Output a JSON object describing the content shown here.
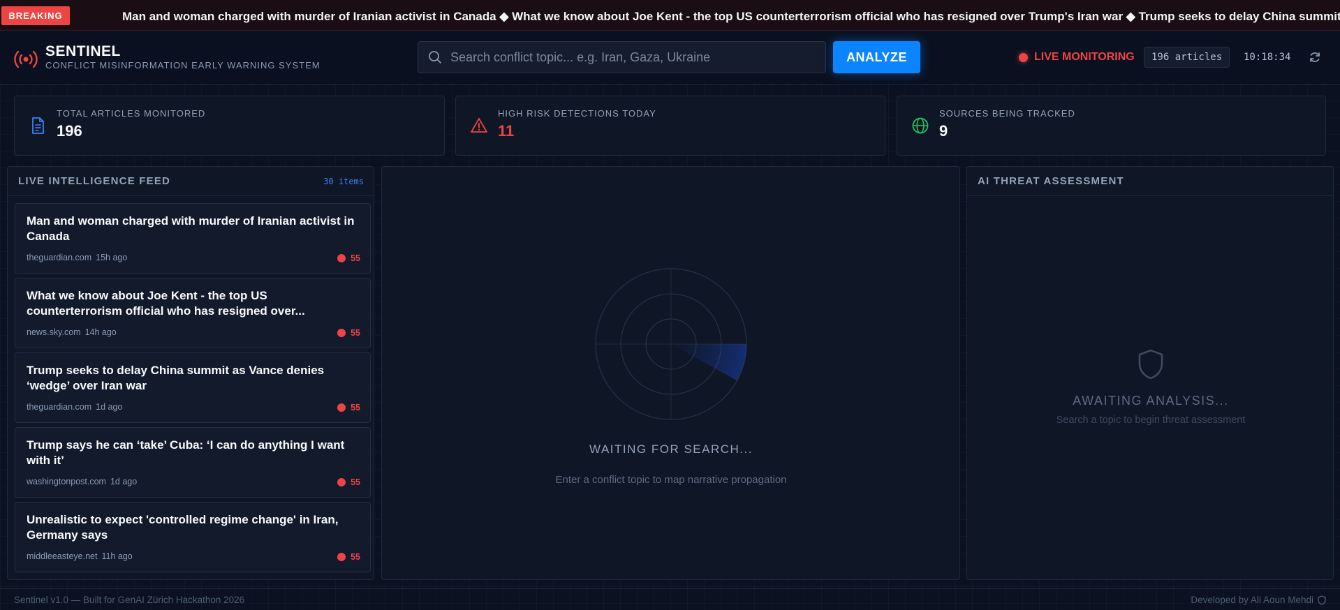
{
  "ticker": {
    "badge": "BREAKING",
    "text": "Man and woman charged with murder of Iranian activist in Canada ◆ What we know about Joe Kent - the top US counterterrorism official who has resigned over Trump's Iran war ◆ Trump seeks to delay China summit as Vance denies ‘wedge’ over Iran war"
  },
  "header": {
    "brand": "SENTINEL",
    "tagline": "CONFLICT MISINFORMATION EARLY WARNING SYSTEM",
    "search_placeholder": "Search conflict topic... e.g. Iran, Gaza, Ukraine",
    "search_value": "",
    "analyze_label": "ANALYZE",
    "live_label": "LIVE MONITORING",
    "article_count": "196 articles",
    "clock": "10:18:34"
  },
  "stats": [
    {
      "label": "TOTAL ARTICLES MONITORED",
      "value": "196",
      "color": "#f9fafb",
      "icon": "document-icon"
    },
    {
      "label": "HIGH RISK DETECTIONS TODAY",
      "value": "11",
      "color": "#ef4444",
      "icon": "warning-icon"
    },
    {
      "label": "SOURCES BEING TRACKED",
      "value": "9",
      "color": "#f9fafb",
      "icon": "globe-icon"
    }
  ],
  "feed": {
    "title": "LIVE INTELLIGENCE FEED",
    "count": "30 items",
    "items": [
      {
        "title": "Man and woman charged with murder of Iranian activist in Canada",
        "source": "theguardian.com",
        "ago": "15h ago",
        "risk": "55"
      },
      {
        "title": "What we know about Joe Kent - the top US counterterrorism official who has resigned over...",
        "source": "news.sky.com",
        "ago": "14h ago",
        "risk": "55"
      },
      {
        "title": "Trump seeks to delay China summit as Vance denies ‘wedge’ over Iran war",
        "source": "theguardian.com",
        "ago": "1d ago",
        "risk": "55"
      },
      {
        "title": "Trump says he can ‘take’ Cuba: ‘I can do anything I want with it’",
        "source": "washingtonpost.com",
        "ago": "1d ago",
        "risk": "55"
      },
      {
        "title": "Unrealistic to expect 'controlled regime change' in Iran, Germany says",
        "source": "middleeasteye.net",
        "ago": "11h ago",
        "risk": "55"
      }
    ]
  },
  "map": {
    "waiting_title": "WAITING FOR SEARCH...",
    "waiting_sub": "Enter a conflict topic to map narrative propagation"
  },
  "threat": {
    "title": "AI THREAT ASSESSMENT",
    "await_title": "AWAITING ANALYSIS...",
    "await_sub": "Search a topic to begin threat assessment"
  },
  "footer": {
    "left": "Sentinel v1.0 — Built for GenAI Zürich Hackathon 2026",
    "right": "Developed by Ali Aoun Mehdi"
  }
}
